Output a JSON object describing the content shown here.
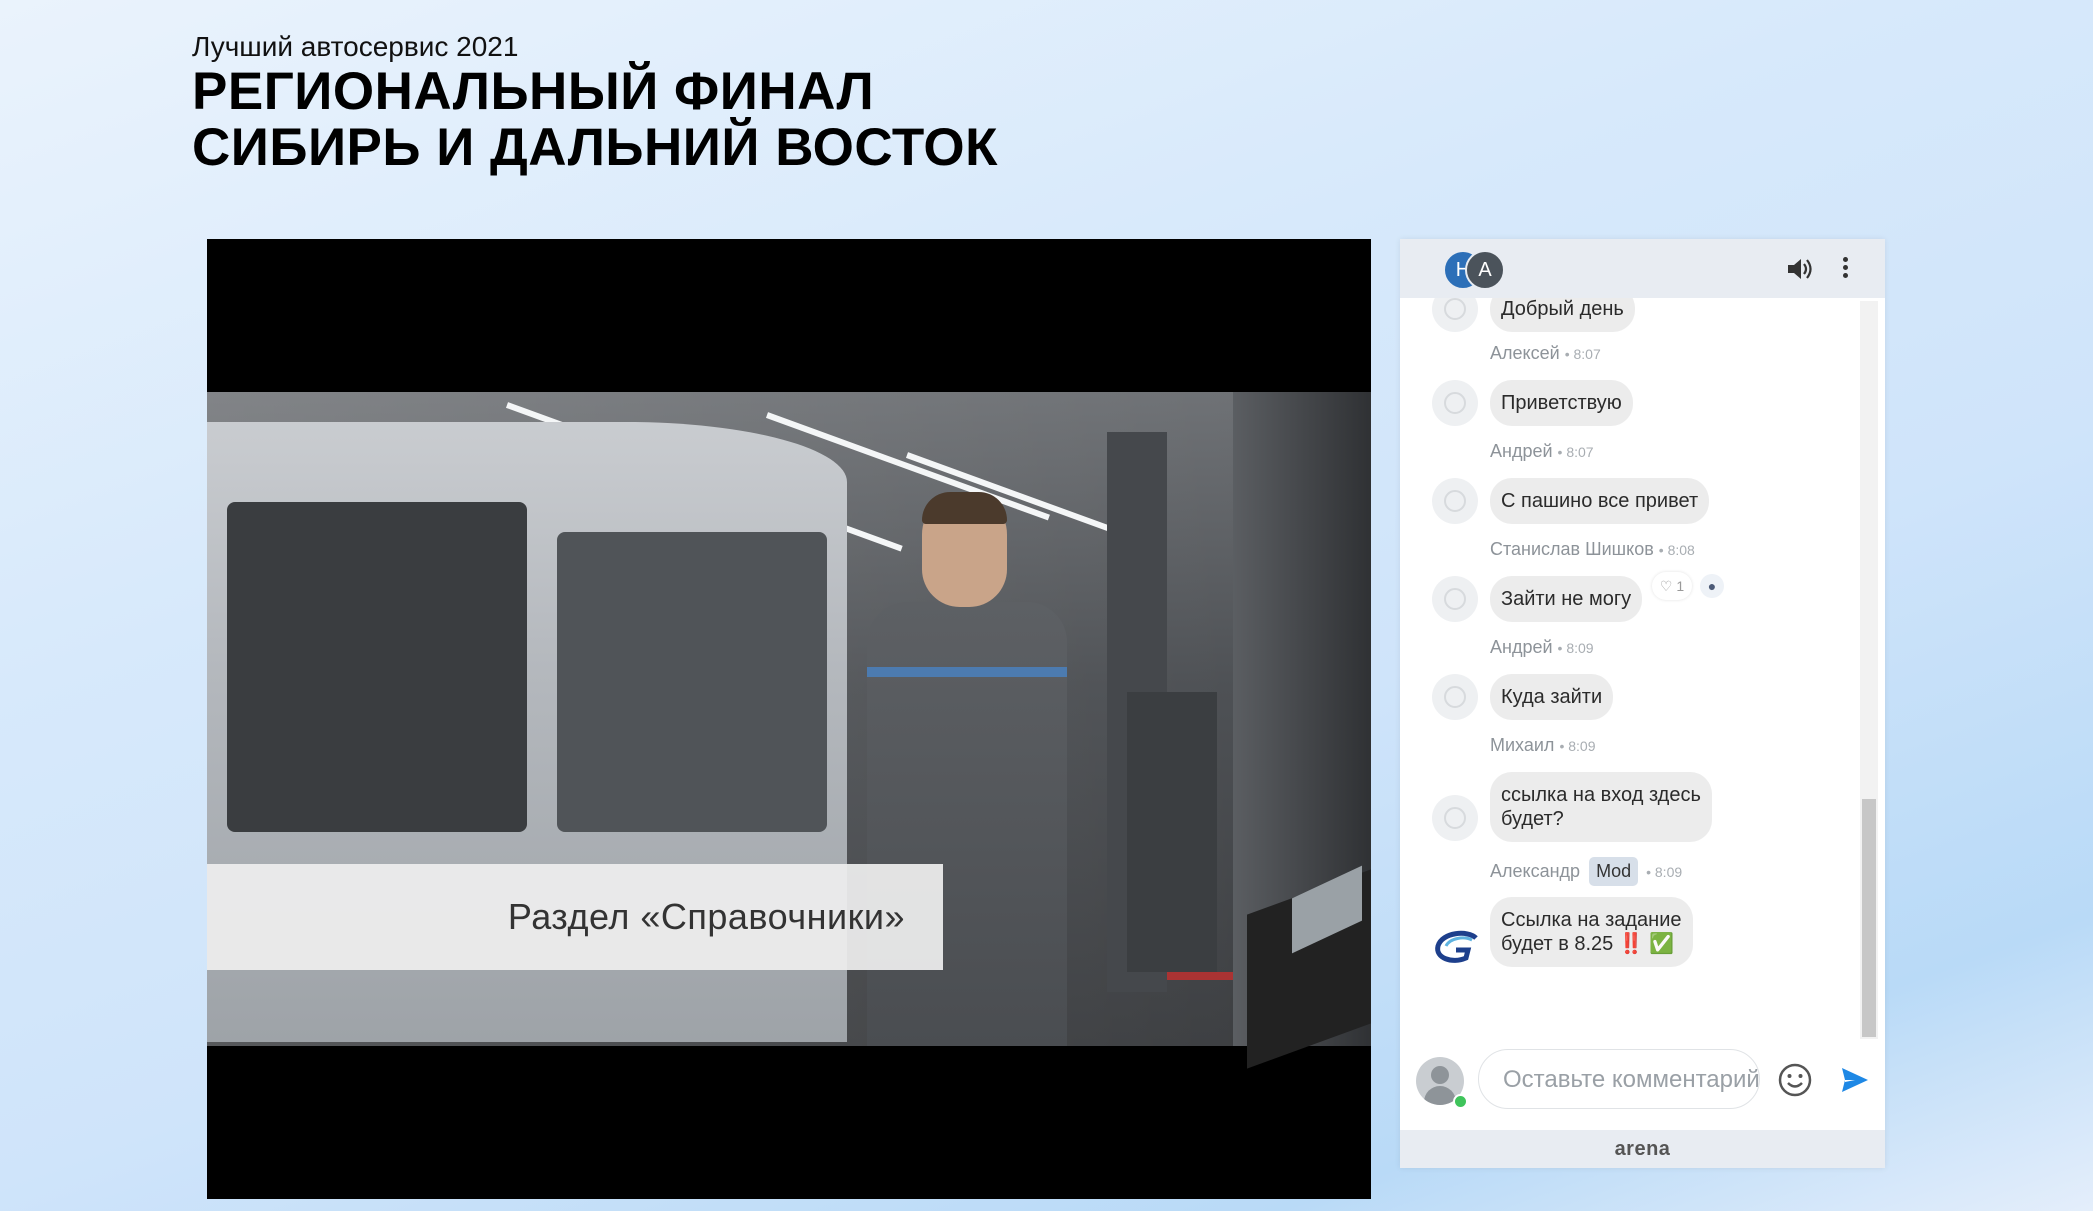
{
  "page": {
    "subtitle": "Лучший автосервис 2021",
    "title_line1": "РЕГИОНАЛЬНЫЙ ФИНАЛ",
    "title_line2": "СИБИРЬ И ДАЛЬНИЙ ВОСТОК"
  },
  "video": {
    "caption": "Раздел «Справочники»"
  },
  "chat": {
    "participants": [
      "Н",
      "А"
    ],
    "header_icons": [
      "speaker-icon",
      "more-vertical-icon"
    ],
    "messages": [
      {
        "author": "",
        "time": "",
        "text": "Добрый день"
      },
      {
        "author": "Алексей",
        "time": "8:07",
        "text": "Приветствую"
      },
      {
        "author": "Андрей",
        "time": "8:07",
        "text": "С пашино все привет",
        "likes": "1"
      },
      {
        "author": "Станислав Шишков",
        "time": "8:08",
        "text": "Зайти не могу"
      },
      {
        "author": "Андрей",
        "time": "8:09",
        "text": "Куда зайти"
      },
      {
        "author": "Михаил",
        "time": "8:09",
        "text_line1": "ссылка на вход здесь",
        "text_line2": "будет?"
      },
      {
        "author": "Александр",
        "badge": "Mod",
        "time": "8:09",
        "text_line1": "Ссылка на задание",
        "text_line2": "будет в 8.25 ‼️ ✅"
      }
    ],
    "input_placeholder": "Оставьте комментарий",
    "footer_brand": "arena",
    "colors": {
      "header_bg": "#e8ecf2",
      "send": "#1e88e5",
      "bubble": "#ececec",
      "online": "#3fc45b"
    }
  }
}
